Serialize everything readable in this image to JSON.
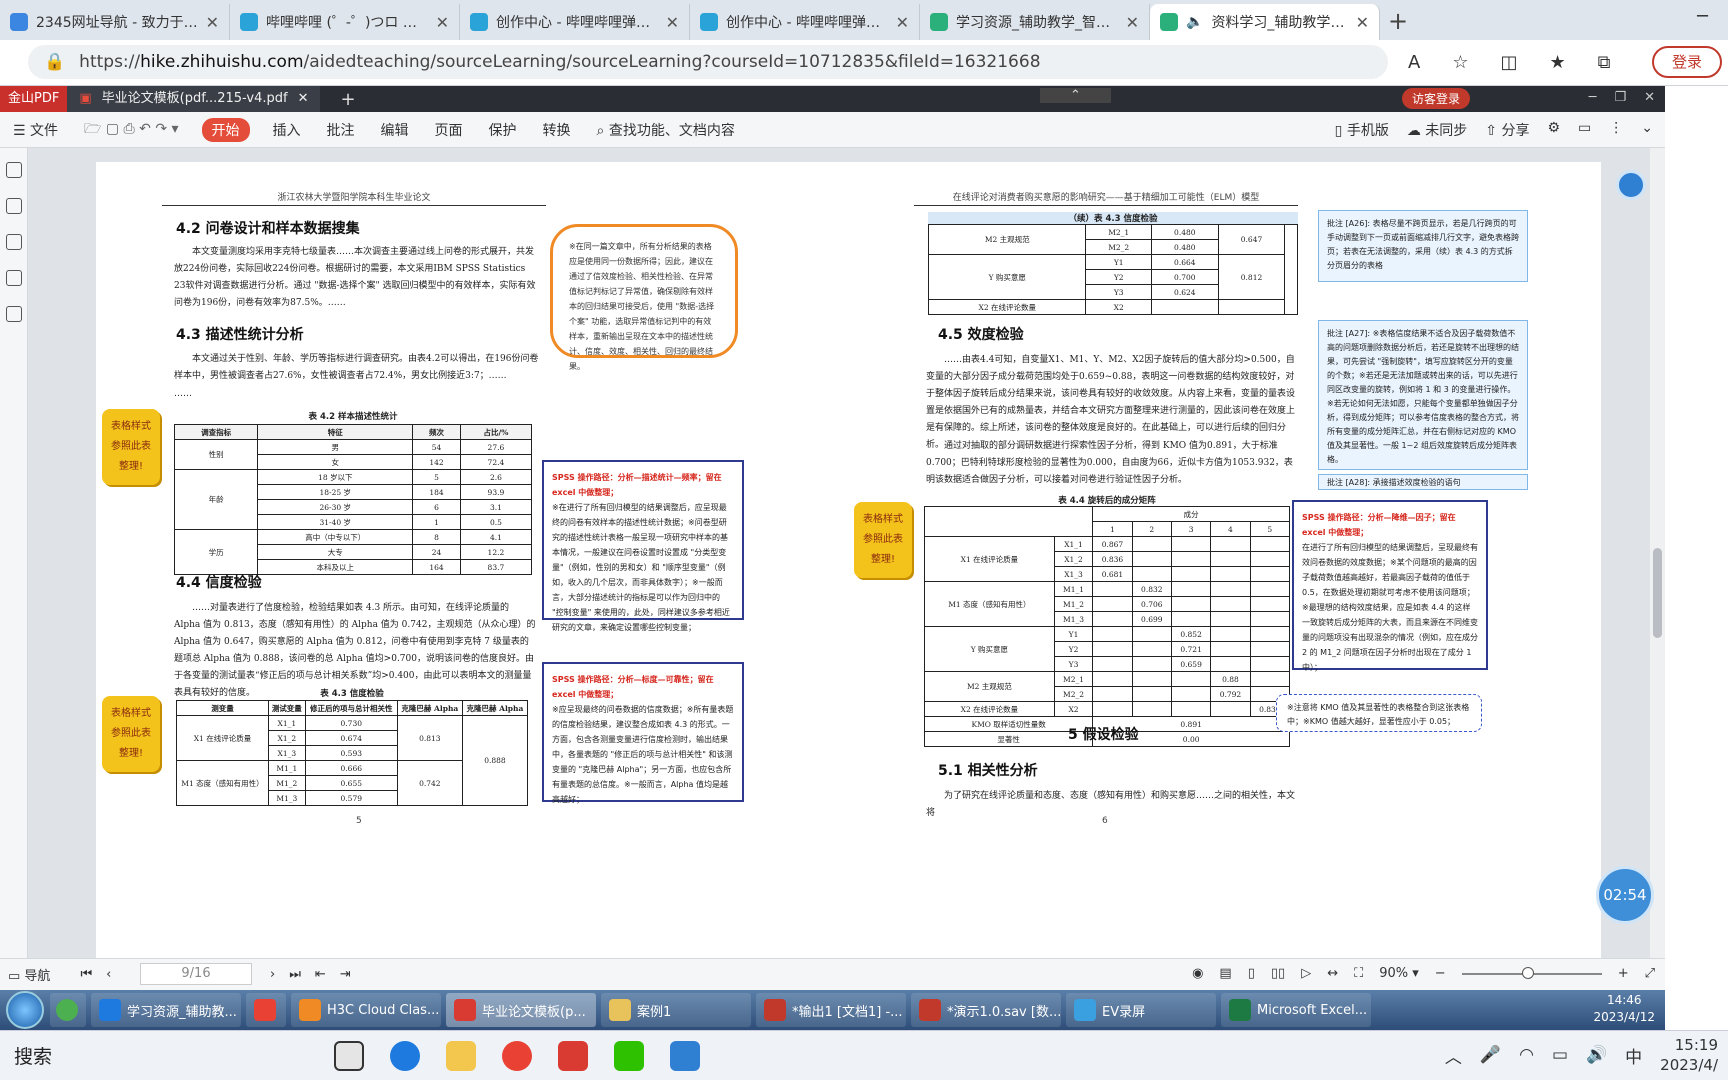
{
  "browser": {
    "tabs": [
      {
        "title": "2345网址导航 - 致力于打造",
        "color": "#3a86e0"
      },
      {
        "title": "哔哩哔哩 (゜-゜)つロ 干杯~",
        "color": "#2aa4d8"
      },
      {
        "title": "创作中心 - 哔哩哔哩弹幕视",
        "color": "#2aa4d8"
      },
      {
        "title": "创作中心 - 哔哩哔哩弹幕视",
        "color": "#2aa4d8"
      },
      {
        "title": "学习资源_辅助教学_智慧树",
        "color": "#2bb07c"
      },
      {
        "title": "资料学习_辅助教学_智",
        "color": "#2bb07c",
        "active": true
      }
    ],
    "url_prefix": "https://",
    "url_host": "hike.zhihuishu.com",
    "url_path": "/aidedteaching/sourceLearning/sourceLearning?courseId=10712835&fileId=16321668",
    "login_label": "登录"
  },
  "wps": {
    "logo": "金山PDF",
    "doc_tab": "毕业论文模板(pdf...215-v4.pdf",
    "page_badge": "1",
    "visitor": "访客登录",
    "menu": [
      "文件",
      "开始",
      "插入",
      "批注",
      "编辑",
      "页面",
      "保护",
      "转换"
    ],
    "search": "查找功能、文档内容",
    "right_tools": [
      "手机版",
      "未同步",
      "分享"
    ],
    "status": {
      "nav": "导航",
      "page": "9/16",
      "zoom": "90%"
    }
  },
  "page5": {
    "header": "浙江农林大学暨阳学院本科生毕业论文",
    "h_4_2": "4.2 问卷设计和样本数据搜集",
    "p_4_2": "本文变量测度均采用李克特七级量表……本次调查主要通过线上问卷的形式展开，共发放224份问卷，实际回收224份问卷。根据研讨的需要，本文采用IBM SPSS Statistics 23软件对调查数据进行分析。通过 \"数据-选择个案\" 选取回归模型中的有效样本，实际有效问卷为196份，问卷有效率为87.5%。……",
    "h_4_3": "4.3 描述性统计分析",
    "p_4_3": "本文通过关于性别、年龄、学历等指标进行调查研究。由表4.2可以得出，在196份问卷样本中，男性被调查者占27.6%，女性被调查者占72.4%，男女比例接近3:7；……",
    "dashes": "……",
    "bubble": "※在同一篇文章中，所有分析结果的表格应是使用同一份数据所得；因此，建议在通过了信效度检验、相关性检验、在异常值标记判标记了异常值，确保剔除有效样本的回归结果可接受后，使用 \"数据-选择个案\" 功能，选取异常值标记判中的有效样本，重新输出呈现在文本中的描述性统计、信度、效度、相关性、回归的最终结果。",
    "bubble_highlight": "\"数据-选择个案\"",
    "tag1": "表格样式参照此表整理!",
    "t42_caption": "表 4.2 样本描述性统计",
    "t42_head": [
      "调查指标",
      "特征",
      "频次",
      "占比/%"
    ],
    "t42_rows": [
      [
        "性别",
        "男",
        "54",
        "27.6"
      ],
      [
        "",
        "女",
        "142",
        "72.4"
      ],
      [
        "年龄",
        "18 岁以下",
        "5",
        "2.6"
      ],
      [
        "",
        "18-25 岁",
        "184",
        "93.9"
      ],
      [
        "",
        "26-30 岁",
        "6",
        "3.1"
      ],
      [
        "",
        "31-40 岁",
        "1",
        "0.5"
      ],
      [
        "学历",
        "高中（中专以下）",
        "8",
        "4.1"
      ],
      [
        "",
        "大专",
        "24",
        "12.2"
      ],
      [
        "",
        "本科及以上",
        "164",
        "83.7"
      ]
    ],
    "rbox1_title": "SPSS 操作路径：分析—描述统计—频率；留在 excel 中做整理；",
    "rbox1_body": "※在进行了所有回归模型的结果调整后，应呈现最终的问卷有效样本的描述性统计数据；※问卷型研究的描述性统计表格一般呈现一项研究中样本的基本情况，一般建议在问卷设置时设置成 \"分类型变量\"（例如，性别的男和女）和 \"顺序型变量\"（例如，收入的几个层次，而非具体数字）；※一般而言，大部分描述统计的指标是可以作为回归中的 \"控制变量\" 来使用的，此处，同样建议多参考相近研究的文章，来确定设置哪些控制变量；",
    "h_4_4": "4.4 信度检验",
    "p_4_4": "……对量表进行了信度检验，检验结果如表 4.3 所示。由可知，在线评论质量的 Alpha 值为 0.813，态度（感知有用性）的 Alpha 值为 0.742，主观规范（从众心理）的 Alpha 值为 0.647，购买意愿的 Alpha 值为 0.812，问卷中有使用到李克特 7 级量表的题项总 Alpha 值为 0.888，该问卷的总 Alpha 值均>0.700，说明该问卷的信度良好。由于各变量的测试量表“修正后的项与总计相关系数”均>0.400，由此可以表明本文的测量量表具有较好的信度。",
    "tag2": "表格样式参照此表整理!",
    "t43_caption": "表 4.3 信度检验",
    "t43_head": [
      "测变量",
      "测试变量",
      "修正后的项与总计相关性",
      "克隆巴赫 Alpha",
      "克隆巴赫 Alpha"
    ],
    "t43_rows": [
      [
        "X1 在线评论质量",
        "X1_1",
        "0.730",
        "0.813",
        "0.888"
      ],
      [
        "",
        "X1_2",
        "0.674",
        "",
        ""
      ],
      [
        "",
        "X1_3",
        "0.593",
        "",
        ""
      ],
      [
        "M1 态度（感知有用性）",
        "M1_1",
        "0.666",
        "0.742",
        ""
      ],
      [
        "",
        "M1_2",
        "0.655",
        "",
        ""
      ],
      [
        "",
        "M1_3",
        "0.579",
        "",
        ""
      ]
    ],
    "rbox2_title": "SPSS 操作路径：分析—标度—可靠性；留在 excel 中做整理；",
    "rbox2_body": "※应呈现最终的问卷数据的信度数据；※所有量表题的信度检验结果，建议整合成如表 4.3 的形式。一方面，包含各测量变量进行信度检测时，输出结果中，各量表题的 \"修正后的项与总计相关性\" 和该测变量的 \"克隆巴赫 Alpha\"；另一方面，也应包含所有量表题的总信度。※一般而言，Alpha 值均是越高越好；",
    "page_no": "5"
  },
  "page6": {
    "header": "在线评论对消费者购买意愿的影响研究——基于精细加工可能性（ELM）模型",
    "t43c_caption": "（续）表 4.3 信度检验",
    "t43c_rows": [
      [
        "M2 主观规范",
        "M2_1",
        "0.480",
        "0.647"
      ],
      [
        "",
        "M2_2",
        "0.480",
        ""
      ],
      [
        "Y 购买意愿",
        "Y1",
        "0.664",
        "0.812"
      ],
      [
        "",
        "Y2",
        "0.700",
        ""
      ],
      [
        "",
        "Y3",
        "0.624",
        ""
      ],
      [
        "X2 在线评论数量",
        "X2",
        "",
        ""
      ]
    ],
    "c1": "批注 [A26]: 表格尽量不跨页显示，若是几行跨页的可手动调整到下一页或前面缩减排几行文字，避免表格跨页；若表在无法调整的，采用（续）表 4.3 的方式拆分页眉分的表格",
    "h_4_5": "4.5 效度检验",
    "p_4_5a": "……由表4.4可知，自变量X1、M1、Y、M2、X2因子旋转后的值大部分均>0.500，自变量的大部分因子成分载荷范围均处于0.659~0.88，表明这一问卷数据的结构效度较好，对于整体因子旋转后成分结果来说，该问卷具有较好的收敛效度。从内容上来看，变量的量表设置是依据国外已有的成熟量表，并结合本文研究方面整理来进行测量的，因此该问卷在效度上是有保障的。综上所述，该问卷的整体效度是良好的。在此基础上，可以进行后续的回归分析。",
    "p_4_5b": "通过对抽取的部分调研数据进行探索性因子分析，得到 KMO 值为0.891，大于标准0.700；巴特利特球形度检验的显著性为0.000，自由度为66，近似卡方值为1053.932，表明该数据适合做因子分析，可以接着对问卷进行验证性因子分析。",
    "c2": "批注 [A27]: ※表格信度结果不适合及因子载荷数值不高的问题项删除数据分析后，若还是旋转不出理想的结果，可先尝试 \"强制旋转\"，填写应旋转区分开的变量的个数；※若还是无法加题或转出来的话，可以先进行同区改变量的旋转，例如将 1 和 3 的变量进行操作。※若无论如何无法如愿，只能每个变量都单独做因子分析，得到成分矩阵；可以参考信度表格的整合方式，将所有变量的成分矩阵汇总，并在右侧标记对应的 KMO 值及其显著性。一般 1~2 组后效度旋转后成分矩阵表格。",
    "c3": "批注 [A28]: 承接描述效度检验的语句",
    "tag3": "表格样式参照此表整理!",
    "t44_caption": "表 4.4 旋转后的成分矩阵",
    "t44_comp": "成分",
    "t44_nums": [
      "1",
      "2",
      "3",
      "4",
      "5"
    ],
    "t44_rows": [
      [
        "X1 在线评论质量",
        "X1_1",
        "0.867",
        "",
        "",
        "",
        ""
      ],
      [
        "",
        "X1_2",
        "0.836",
        "",
        "",
        "",
        ""
      ],
      [
        "",
        "X1_3",
        "0.681",
        "",
        "",
        "",
        ""
      ],
      [
        "M1 态度（感知有用性）",
        "M1_1",
        "",
        "0.832",
        "",
        "",
        ""
      ],
      [
        "",
        "M1_2",
        "",
        "0.706",
        "",
        "",
        ""
      ],
      [
        "",
        "M1_3",
        "",
        "0.699",
        "",
        "",
        ""
      ],
      [
        "Y 购买意愿",
        "Y1",
        "",
        "",
        "0.852",
        "",
        ""
      ],
      [
        "",
        "Y2",
        "",
        "",
        "0.721",
        "",
        ""
      ],
      [
        "",
        "Y3",
        "",
        "",
        "0.659",
        "",
        ""
      ],
      [
        "M2 主观规范",
        "M2_1",
        "",
        "",
        "",
        "0.88",
        ""
      ],
      [
        "",
        "M2_2",
        "",
        "",
        "",
        "0.792",
        ""
      ],
      [
        "X2 在线评论数量",
        "X2",
        "",
        "",
        "",
        "",
        "0.833"
      ]
    ],
    "t44_kmo": [
      "KMO 取样适切性量数",
      "0.891"
    ],
    "t44_sig": [
      "显著性",
      "0.00"
    ],
    "rbox3_title": "SPSS 操作路径：分析—降维—因子；留在 excel 中做整理；",
    "rbox3_body": "在进行了所有回归模型的结果调整后，呈现最终有效问卷数据的效度数据；※某个问题项的最高的因子载荷数值越高越好，若最高因子载荷的值低于0.5，在数据处理初期就可考虑不使用该问题项；※最理想的结构效度结果，应是如表 4.4 的这样一致旋转后成分矩阵的大表，而且来源在不同维变量的问题项没有出现混杂的情况（例如，应在成分 2 的 M1_2 问题项在因子分析时出现在了成分 1 中）；",
    "dbox": "※注意将 KMO 值及其显著性的表格整合到这张表格中；※KMO 值越大越好，显著性应小于 0.05；",
    "h_5": "5 假设检验",
    "h_5_1": "5.1 相关性分析",
    "p_5_1": "为了研究在线评论质量和态度、态度（感知有用性）和购买意愿……之间的相关性，本文将",
    "page_no": "6"
  },
  "timer": "02:54",
  "win7": {
    "items": [
      {
        "label": "学习资源_辅助教...",
        "color": "#1f7ae0"
      },
      {
        "label": "",
        "color": "#e94235"
      },
      {
        "label": "H3C Cloud Clas...",
        "color": "#f08a24"
      },
      {
        "label": "毕业论文模板(p...",
        "color": "#d93a32",
        "active": true
      },
      {
        "label": "案例1",
        "color": "#e8c25a"
      },
      {
        "label": "*输出1 [文档1] -...",
        "color": "#c0392b"
      },
      {
        "label": "*演示1.0.sav [数...",
        "color": "#c0392b"
      },
      {
        "label": "EV录屏",
        "color": "#3aa0e0"
      },
      {
        "label": "Microsoft Excel...",
        "color": "#1e7a43"
      }
    ],
    "time": "14:46",
    "date": "2023/4/12"
  },
  "win10": {
    "search": "搜索",
    "ime": "中",
    "time": "15:19",
    "date": "2023/4/"
  }
}
